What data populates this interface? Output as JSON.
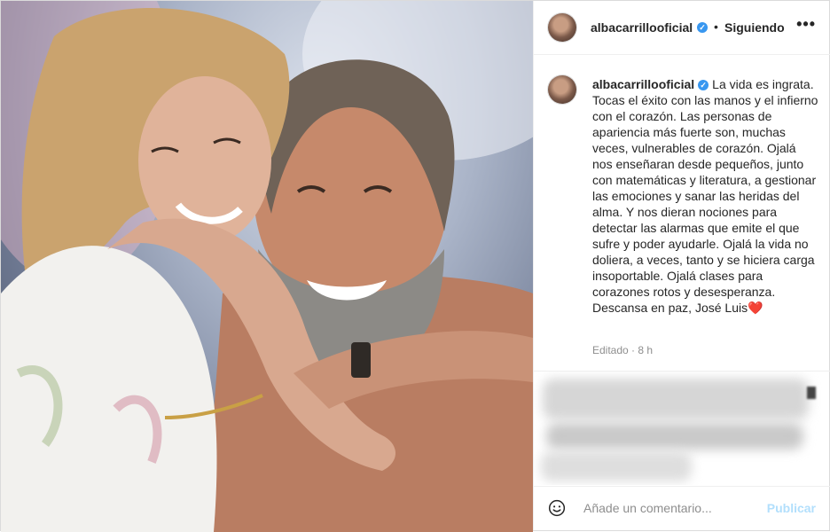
{
  "header": {
    "username": "albacarrillooficial",
    "verified_glyph": "✓",
    "separator": "•",
    "follow_status": "Siguiendo",
    "more_glyph": "•••"
  },
  "caption": {
    "username": "albacarrillooficial",
    "verified_glyph": "✓",
    "text": "La vida es ingrata. Tocas el éxito con las manos y el infierno con el corazón. Las personas de apariencia más fuerte son, muchas veces, vulnerables de corazón. Ojalá nos enseñaran desde pequeños, junto con matemáticas y literatura, a gestionar las emociones y sanar las heridas del alma. Y nos dieran nociones para detectar las alarmas que emite el que sufre y poder ayudarle. Ojalá la vida no doliera, a veces, tanto y se hiciera carga insoportable. Ojalá clases para corazones rotos y desesperanza. Descansa en paz, José Luis",
    "emoji": "❤️",
    "meta": "Editado · 8 h"
  },
  "comment_bar": {
    "placeholder": "Añade un comentario...",
    "publish_label": "Publicar"
  },
  "colors": {
    "verified": "#3897f0",
    "publish_disabled": "#b2dffc",
    "meta_text": "#8e8e8e",
    "border": "#dbdbdb"
  },
  "icons": [
    "verified-badge-icon",
    "more-options-icon",
    "emoji-icon",
    "heart-emoji-icon"
  ]
}
